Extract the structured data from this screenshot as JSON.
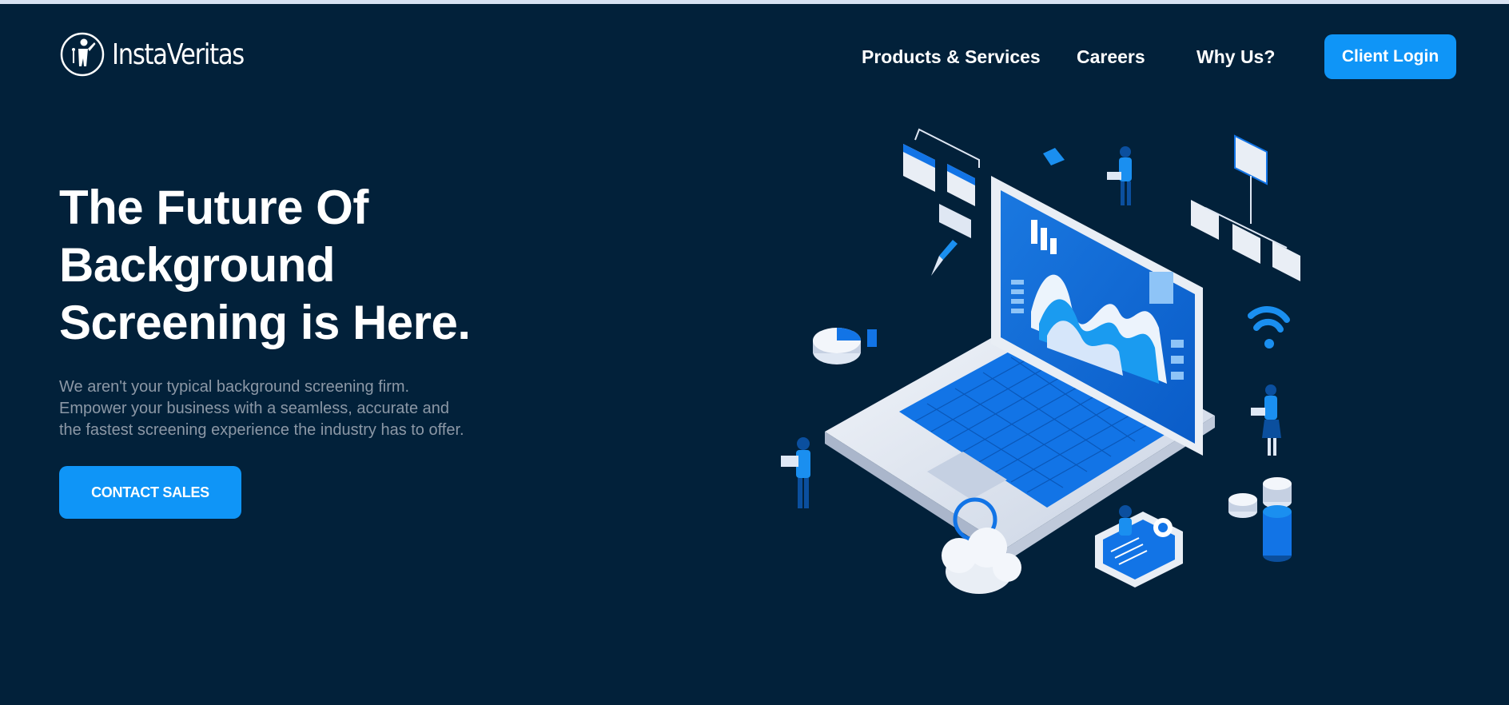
{
  "brand": {
    "name": "InstaVeritas",
    "icon": "person-circle-logo-icon"
  },
  "nav": {
    "items": [
      {
        "label": "Products & Services"
      },
      {
        "label": "Careers"
      },
      {
        "label": "Why Us?"
      }
    ],
    "login_label": "Client Login"
  },
  "hero": {
    "title_lines": [
      "The Future Of",
      "Background",
      "Screening is Here."
    ],
    "description_lines": [
      "We aren't your typical background screening firm.",
      "Empower your business with a seamless, accurate and",
      "the fastest screening experience the industry has to offer."
    ],
    "cta_label": "CONTACT SALES"
  },
  "illustration": {
    "icon": "isometric-laptop-analytics-illustration"
  },
  "colors": {
    "background": "#02213a",
    "accent": "#0f95f7",
    "text": "#ffffff",
    "muted_text": "#8c98a6"
  }
}
